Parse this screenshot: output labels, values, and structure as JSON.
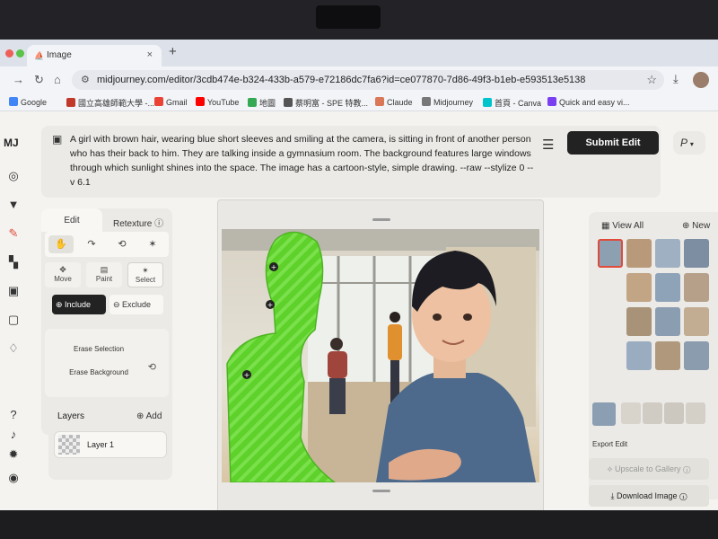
{
  "browser": {
    "tab_title": "Image",
    "url": "midjourney.com/editor/3cdb474e-b324-433b-a579-e72186dc7fa6?id=ce077870-7d86-49f3-b1eb-e593513e5138",
    "bookmarks": [
      "Google",
      "國立高雄師範大學 -...",
      "Gmail",
      "YouTube",
      "地圖",
      "蔡明富 - SPE 特教...",
      "Claude",
      "Midjourney",
      "首頁 - Canva",
      "Quick and easy vi..."
    ]
  },
  "app": {
    "logo": "MJ",
    "prompt": "A girl with brown hair, wearing blue short sleeves and smiling at the camera, is sitting in front of another person who has their back to him. They are talking inside a gymnasium room. The background features large windows through which sunlight shines into the space. The image has a cartoon-style, simple drawing. --raw --stylize 0 --v 6.1",
    "submit_label": "Submit Edit",
    "profile_letter": "P"
  },
  "tools": {
    "tab_edit": "Edit",
    "tab_retexture": "Retexture",
    "move": "Move",
    "paint": "Paint",
    "select": "Select",
    "include": "Include",
    "exclude": "Exclude",
    "erase_selection": "Erase Selection",
    "erase_background": "Erase Background"
  },
  "layers": {
    "title": "Layers",
    "add": "Add",
    "items": [
      "Layer 1"
    ]
  },
  "right_panel": {
    "view_all": "View All",
    "new": "New",
    "export_label": "Export Edit",
    "upscale": "Upscale to Gallery",
    "download": "Download Image"
  },
  "colors": {
    "mask_green": "#5ed12a",
    "accent_dark": "#222222",
    "shirt_blue": "#4d6a8c"
  }
}
